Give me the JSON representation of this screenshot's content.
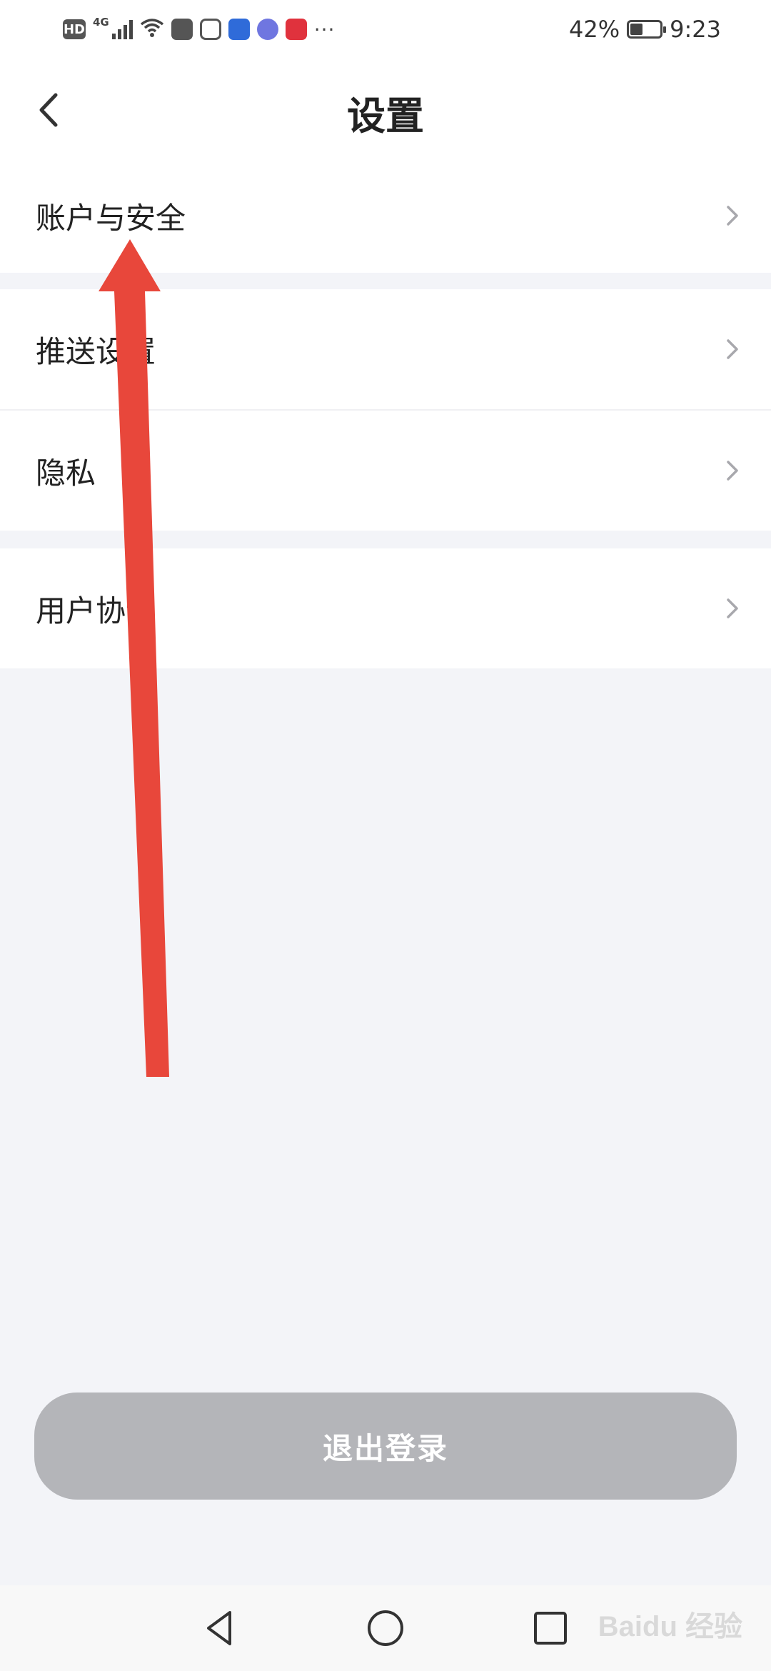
{
  "status_bar": {
    "network_label": "4G",
    "hd_label": "HD",
    "more": "···",
    "battery_percent": "42%",
    "battery_level": 0.42,
    "time": "9:23"
  },
  "header": {
    "title": "设置",
    "back_icon": "chevron-left-icon"
  },
  "settings": {
    "groups": [
      {
        "items": [
          {
            "label": "账户与安全"
          }
        ]
      },
      {
        "items": [
          {
            "label": "推送设置"
          },
          {
            "label": "隐私"
          }
        ]
      },
      {
        "items": [
          {
            "label": "用户协议"
          }
        ]
      }
    ]
  },
  "logout": {
    "label": "退出登录"
  },
  "nav_bar": {
    "back_icon": "triangle-back-icon",
    "home_icon": "circle-home-icon",
    "recents_icon": "square-recents-icon"
  },
  "watermark": {
    "text": "Baidu 经验"
  },
  "colors": {
    "background": "#f3f4f8",
    "card": "#ffffff",
    "logout_button": "#b4b5b9",
    "annotation_arrow": "#e8473b"
  }
}
